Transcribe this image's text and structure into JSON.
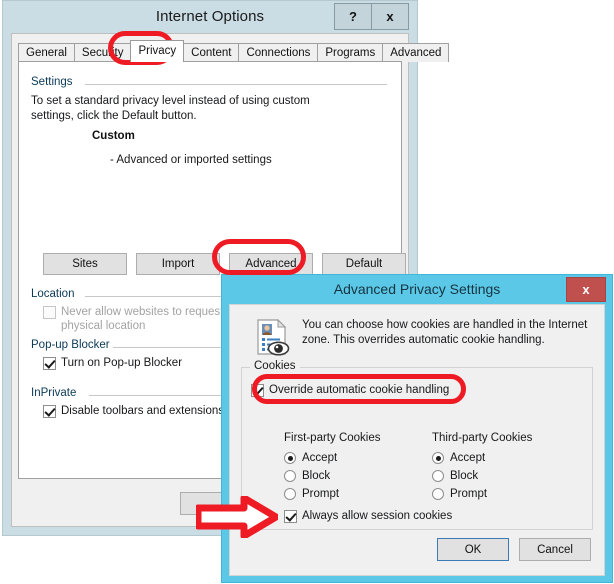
{
  "internet_options": {
    "title": "Internet Options",
    "sys_buttons": [
      {
        "name": "help-button",
        "label": "?"
      },
      {
        "name": "close-button",
        "label": "x"
      }
    ],
    "tabs": [
      {
        "label": "General",
        "active": false
      },
      {
        "label": "Security",
        "active": false
      },
      {
        "label": "Privacy",
        "active": true
      },
      {
        "label": "Content",
        "active": false
      },
      {
        "label": "Connections",
        "active": false
      },
      {
        "label": "Programs",
        "active": false
      },
      {
        "label": "Advanced",
        "active": false
      }
    ],
    "settings_group": {
      "label": "Settings",
      "description": "To set a standard privacy level instead of using custom settings, click the Default button.",
      "level_name": "Custom",
      "level_detail": "- Advanced or imported settings"
    },
    "buttons": [
      {
        "label": "Sites"
      },
      {
        "label": "Import"
      },
      {
        "label": "Advanced"
      },
      {
        "label": "Default"
      }
    ],
    "location_group": {
      "label": "Location",
      "checkbox_label": "Never allow websites to request your physical location",
      "checked": false,
      "disabled": true
    },
    "popup_group": {
      "label": "Pop-up Blocker",
      "checkbox_label": "Turn on Pop-up Blocker",
      "checked": true
    },
    "inprivate_group": {
      "label": "InPrivate",
      "checkbox_label": "Disable toolbars and extensions when",
      "checked": true
    }
  },
  "advanced_privacy_settings": {
    "title": "Advanced Privacy Settings",
    "close_label": "x",
    "icon": "privacy-document-eye-icon",
    "description": "You can choose how cookies are handled in the Internet zone.  This overrides automatic cookie handling.",
    "cookies_group": {
      "legend": "Cookies",
      "override_label": "Override automatic cookie handling",
      "override_checked": true,
      "first_party": {
        "heading": "First-party Cookies",
        "options": [
          "Accept",
          "Block",
          "Prompt"
        ],
        "selected": "Accept"
      },
      "third_party": {
        "heading": "Third-party Cookies",
        "options": [
          "Accept",
          "Block",
          "Prompt"
        ],
        "selected": "Accept"
      },
      "session_label": "Always allow session cookies",
      "session_checked": true
    },
    "ok_label": "OK",
    "cancel_label": "Cancel"
  },
  "annotations": {
    "highlight_color": "#ee1b24",
    "items": [
      {
        "name": "privacy-tab-highlight"
      },
      {
        "name": "advanced-button-highlight"
      },
      {
        "name": "override-cookie-handling-highlight"
      },
      {
        "name": "session-cookies-arrow"
      }
    ]
  },
  "colors": {
    "window_chrome": "#cbdde4",
    "dialog_title": "#5cc8e8",
    "close_red": "#c0504d",
    "annotation_red": "#ee1b24"
  }
}
